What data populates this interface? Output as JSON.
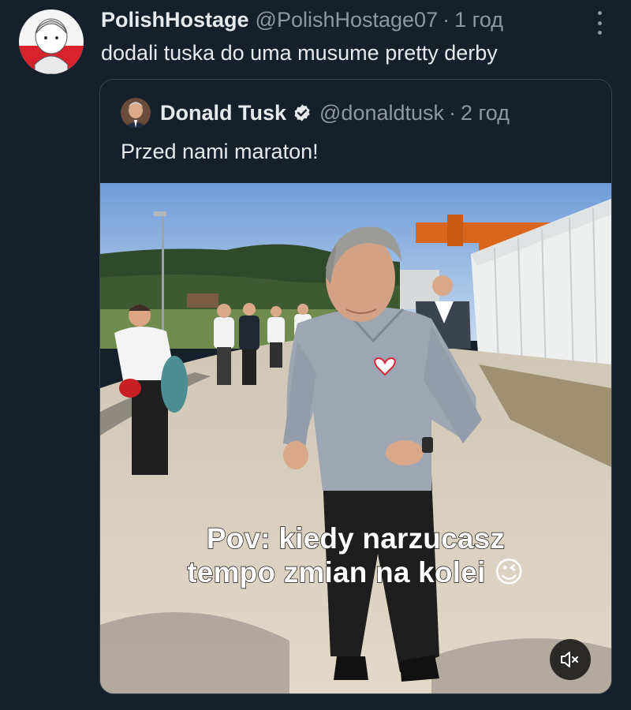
{
  "tweet": {
    "display_name": "PolishHostage",
    "handle": "@PolishHostage07",
    "separator": "·",
    "time": "1 год",
    "text": "dodali tuska do uma musume pretty derby"
  },
  "quoted_tweet": {
    "display_name": "Donald Tusk",
    "handle": "@donaldtusk",
    "separator": "·",
    "time": "2 год",
    "text": "Przed nami maraton!",
    "verified": true,
    "verified_color": "#1d9bf0"
  },
  "media": {
    "caption_line1": "Pov: kiedy narzucasz",
    "caption_line2": "tempo zmian na kolei",
    "caption_emoji": "😉",
    "mute_icon": "speaker-muted-icon"
  },
  "icons": {
    "more": "more-options-icon",
    "verified": "verified-badge-icon"
  },
  "colors": {
    "background": "#15202b",
    "secondary_text": "#8b98a5",
    "border": "#38444d"
  }
}
